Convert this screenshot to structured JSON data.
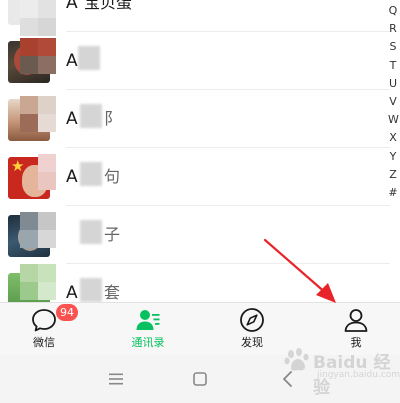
{
  "contacts": [
    {
      "name_initial": "A",
      "name_tail": "□□□",
      "tail_text": "宝贝蛋",
      "avatar": "avatar-a0"
    },
    {
      "name_initial": "A",
      "name_tail": "",
      "tail_text": "",
      "avatar": "avatar-a1"
    },
    {
      "name_initial": "A",
      "name_tail": "",
      "tail_text": "阝",
      "avatar": "avatar-a2"
    },
    {
      "name_initial": "A",
      "name_tail": "",
      "tail_text": "句",
      "avatar": "avatar-a3"
    },
    {
      "name_initial": "",
      "name_tail": "",
      "tail_text": "子",
      "avatar": "avatar-a4"
    },
    {
      "name_initial": "A",
      "name_tail": "",
      "tail_text": "套",
      "avatar": "avatar-a5"
    }
  ],
  "alphabet_index": [
    "Q",
    "R",
    "S",
    "T",
    "U",
    "V",
    "W",
    "X",
    "Y",
    "Z",
    "#"
  ],
  "tabbar": {
    "tabs": [
      {
        "id": "chats",
        "label": "微信",
        "icon": "chat-bubble-icon",
        "active": false,
        "badge": "94"
      },
      {
        "id": "contacts",
        "label": "通讯录",
        "icon": "contacts-icon",
        "active": true
      },
      {
        "id": "discover",
        "label": "发现",
        "icon": "compass-icon",
        "active": false
      },
      {
        "id": "me",
        "label": "我",
        "icon": "person-icon",
        "active": false
      }
    ]
  },
  "system_nav": {
    "buttons": [
      "menu-icon",
      "home-icon",
      "back-icon"
    ]
  },
  "watermark": {
    "text": "Baidu 经验",
    "sub": "jingyan.baidu.com"
  },
  "colors": {
    "accent": "#07c160",
    "badge": "#fa5151",
    "annotation": "#e8242a"
  }
}
